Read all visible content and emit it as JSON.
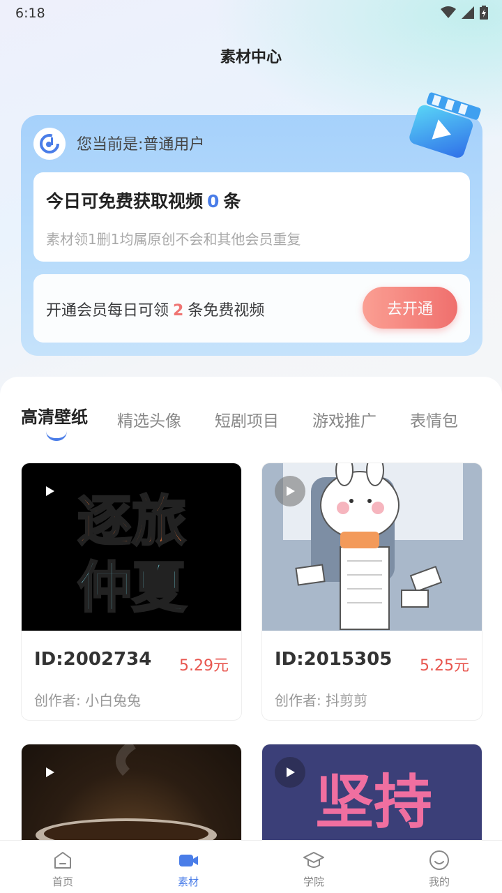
{
  "status_bar": {
    "time": "6:18"
  },
  "header": {
    "title": "素材中心"
  },
  "member": {
    "status": "您当前是:普通用户",
    "quota_prefix": "今日可免费获取视频",
    "quota_count": "0",
    "quota_suffix": "条",
    "quota_desc": "素材领1删1均属原创不会和其他会员重复",
    "vip_prefix": "开通会员每日可领",
    "vip_count": "2",
    "vip_suffix": "条免费视频",
    "vip_button": "去开通"
  },
  "tabs": [
    {
      "label": "高清壁纸"
    },
    {
      "label": "精选头像"
    },
    {
      "label": "短剧项目"
    },
    {
      "label": "游戏推广"
    },
    {
      "label": "表情包"
    }
  ],
  "cards": [
    {
      "id": "ID:2002734",
      "price": "5.29元",
      "author": "创作者: 小白兔兔",
      "thumb_text_1": "逐旅",
      "thumb_text_2": "仲夏"
    },
    {
      "id": "ID:2015305",
      "price": "5.25元",
      "author": "创作者: 抖剪剪"
    },
    {},
    {
      "thumb_text": "坚持"
    }
  ],
  "bottom_nav": [
    {
      "label": "首页",
      "icon": "home-icon"
    },
    {
      "label": "素材",
      "icon": "video-icon"
    },
    {
      "label": "学院",
      "icon": "graduation-cap-icon"
    },
    {
      "label": "我的",
      "icon": "smile-icon"
    }
  ],
  "colors": {
    "accent": "#4a7de8",
    "price": "#e8564f",
    "vip_button": "#f26a66"
  }
}
